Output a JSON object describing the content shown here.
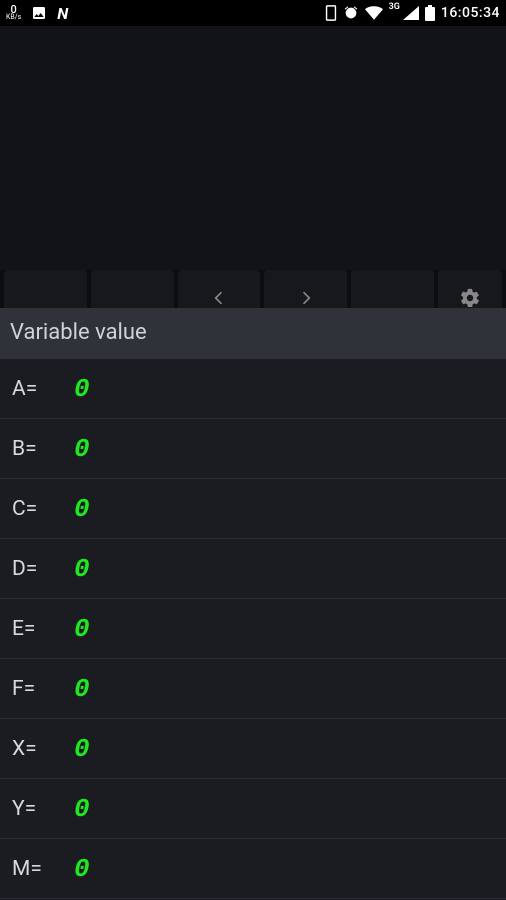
{
  "status": {
    "kbps_value": "0",
    "kbps_label": "KB/s",
    "network_label": "3G",
    "time": "16:05:34"
  },
  "sheet": {
    "title": "Variable value"
  },
  "variables": [
    {
      "name": "A=",
      "value": "0"
    },
    {
      "name": "B=",
      "value": "0"
    },
    {
      "name": "C=",
      "value": "0"
    },
    {
      "name": "D=",
      "value": "0"
    },
    {
      "name": "E=",
      "value": "0"
    },
    {
      "name": "F=",
      "value": "0"
    },
    {
      "name": "X=",
      "value": "0"
    },
    {
      "name": "Y=",
      "value": "0"
    },
    {
      "name": "M=",
      "value": "0"
    }
  ]
}
